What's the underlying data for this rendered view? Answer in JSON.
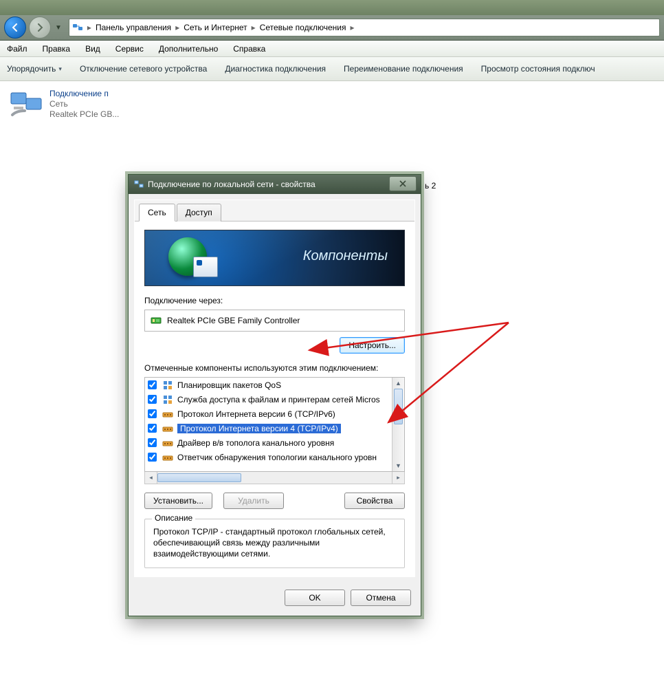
{
  "breadcrumb": [
    "Панель управления",
    "Сеть и Интернет",
    "Сетевые подключения"
  ],
  "menubar": [
    "Файл",
    "Правка",
    "Вид",
    "Сервис",
    "Дополнительно",
    "Справка"
  ],
  "cmdbar": [
    "Упорядочить",
    "Отключение сетевого устройства",
    "Диагностика подключения",
    "Переименование подключения",
    "Просмотр состояния подключ"
  ],
  "connection": {
    "name": "Подключение п",
    "network": "Сеть",
    "adapter_short": "Realtek PCIe GB..."
  },
  "partial_item_suffix": "ь 2",
  "dialog": {
    "title": "Подключение по локальной сети - свойства",
    "tabs": [
      "Сеть",
      "Доступ"
    ],
    "banner": "Компоненты",
    "connect_using_label": "Подключение через:",
    "adapter": "Realtek PCIe GBE Family Controller",
    "configure_btn": "Настроить...",
    "components_label": "Отмеченные компоненты используются этим подключением:",
    "components": [
      {
        "checked": true,
        "icon": "service",
        "label": "Планировщик пакетов QoS",
        "selected": false
      },
      {
        "checked": true,
        "icon": "service",
        "label": "Служба доступа к файлам и принтерам сетей Micros",
        "selected": false
      },
      {
        "checked": true,
        "icon": "protocol",
        "label": "Протокол Интернета версии 6 (TCP/IPv6)",
        "selected": false
      },
      {
        "checked": true,
        "icon": "protocol",
        "label": "Протокол Интернета версии 4 (TCP/IPv4)",
        "selected": true
      },
      {
        "checked": true,
        "icon": "protocol",
        "label": "Драйвер в/в тополога канального уровня",
        "selected": false
      },
      {
        "checked": true,
        "icon": "protocol",
        "label": "Ответчик обнаружения топологии канального уровн",
        "selected": false
      }
    ],
    "install_btn": "Установить...",
    "uninstall_btn": "Удалить",
    "properties_btn": "Свойства",
    "description_legend": "Описание",
    "description_text": "Протокол TCP/IP - стандартный протокол глобальных сетей, обеспечивающий связь между различными взаимодействующими сетями.",
    "ok_btn": "OK",
    "cancel_btn": "Отмена"
  }
}
